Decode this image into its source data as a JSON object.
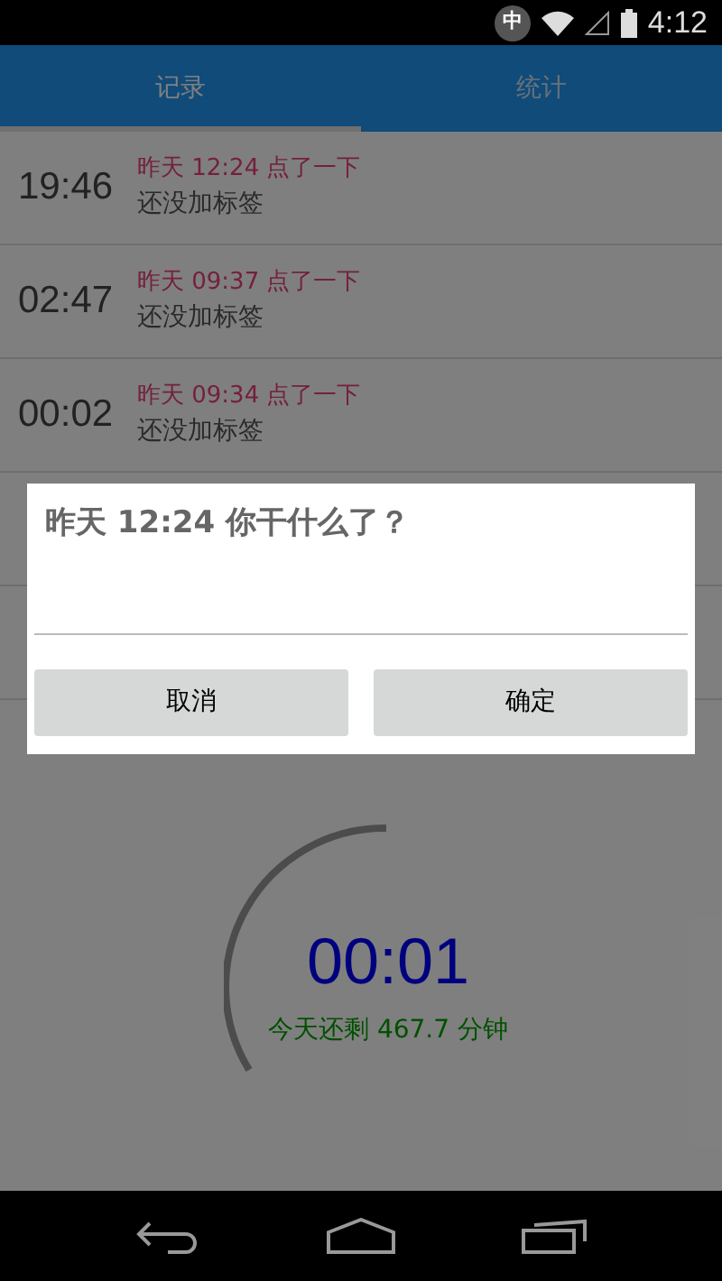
{
  "status_bar": {
    "ime": "中",
    "time": "4:12"
  },
  "tabs": [
    {
      "label": "记录",
      "selected": true
    },
    {
      "label": "统计",
      "selected": false
    }
  ],
  "records": [
    {
      "duration": "19:46",
      "event": "昨天 12:24 点了一下",
      "tag": "还没加标签"
    },
    {
      "duration": "02:47",
      "event": "昨天 09:37 点了一下",
      "tag": "还没加标签"
    },
    {
      "duration": "00:02",
      "event": "昨天 09:34 点了一下",
      "tag": "还没加标签"
    }
  ],
  "timer": {
    "elapsed": "00:01",
    "remaining": "今天还剩 467.7 分钟"
  },
  "dialog": {
    "title": "昨天 12:24 你干什么了？",
    "buttons": [
      "取消",
      "确定"
    ]
  }
}
